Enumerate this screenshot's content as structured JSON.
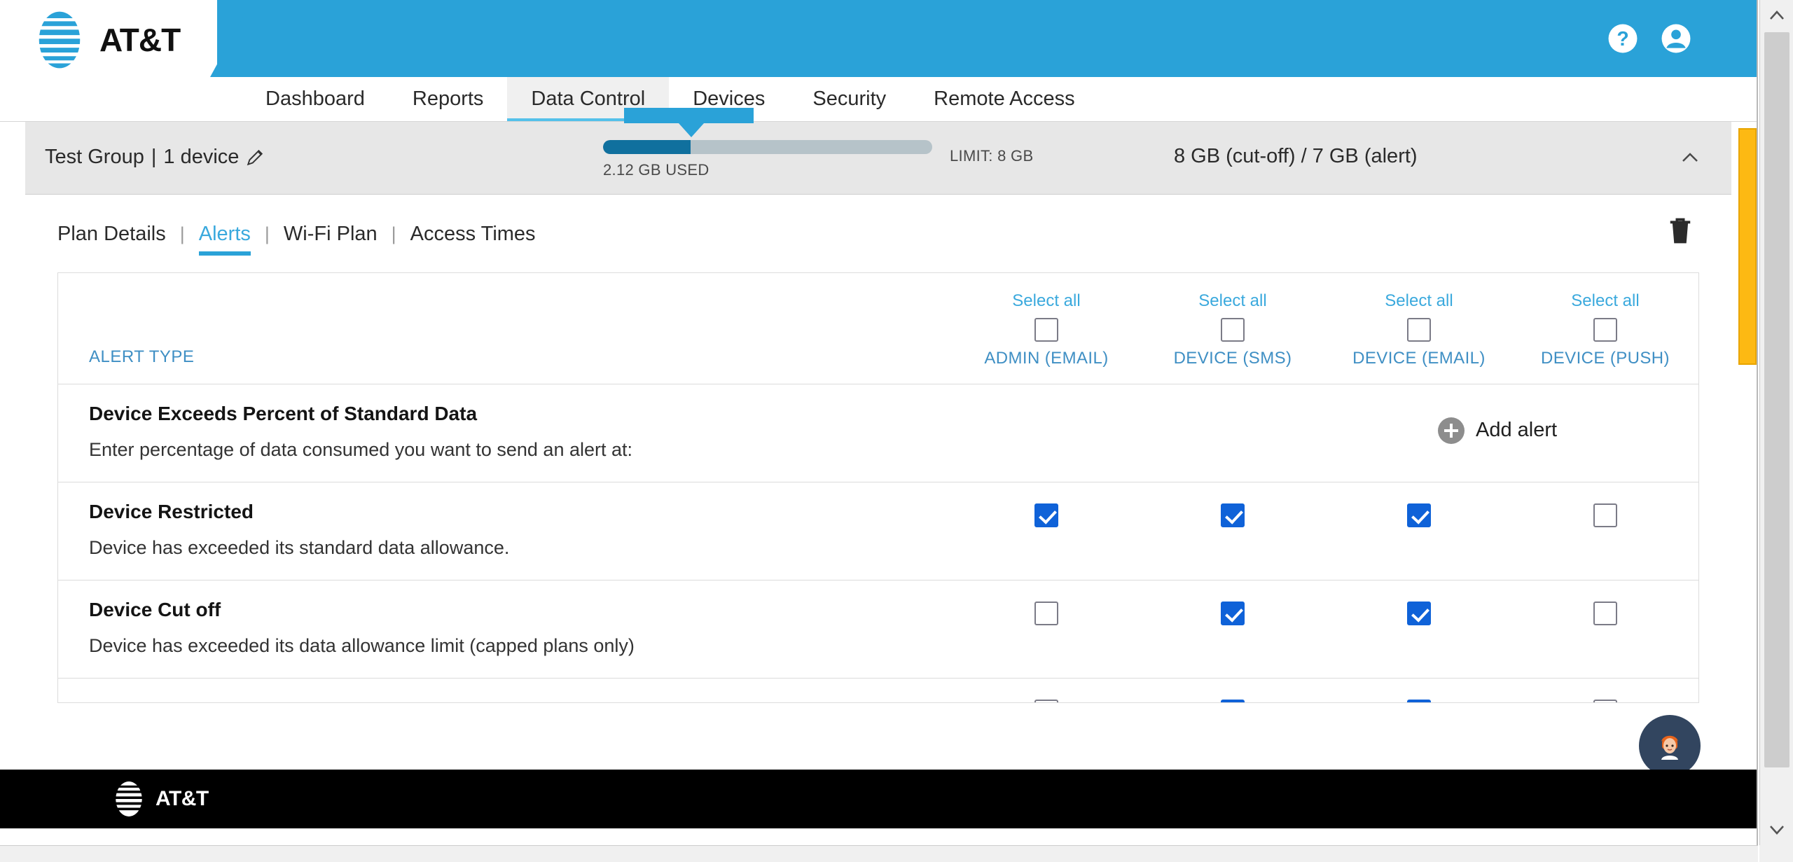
{
  "brand": {
    "name": "AT&T",
    "logo_icon": "att-globe-icon",
    "header_color": "#2aa2d8",
    "footer_name": "AT&T"
  },
  "header": {
    "help_icon": "help-circle-icon",
    "account_icon": "user-account-icon"
  },
  "nav": {
    "items": [
      {
        "label": "Dashboard",
        "active": false
      },
      {
        "label": "Reports",
        "active": false
      },
      {
        "label": "Data Control",
        "active": true
      },
      {
        "label": "Devices",
        "active": false
      },
      {
        "label": "Security",
        "active": false
      },
      {
        "label": "Remote Access",
        "active": false
      }
    ]
  },
  "group": {
    "name": "Test Group",
    "separator": "|",
    "device_count": "1 device",
    "edit_icon": "pencil-edit-icon",
    "usage_used": "2.12 GB USED",
    "usage_limit": "LIMIT: 8 GB",
    "usage_percent": 26.5,
    "thresholds": "8 GB (cut-off) / 7 GB (alert)",
    "collapse_icon": "chevron-up-icon",
    "bar_fill_color": "#10709e",
    "bar_track_color": "#b6c3c9"
  },
  "subtabs": {
    "items": [
      {
        "label": "Plan Details",
        "active": false
      },
      {
        "label": "Alerts",
        "active": true
      },
      {
        "label": "Wi-Fi Plan",
        "active": false
      },
      {
        "label": "Access Times",
        "active": false
      }
    ],
    "separator": "|",
    "delete_icon": "trash-delete-icon"
  },
  "alerts_table": {
    "type_column_header": "ALERT TYPE",
    "select_all_label": "Select all",
    "channels": [
      {
        "label": "ADMIN (EMAIL)",
        "select_all_checked": false
      },
      {
        "label": "DEVICE (SMS)",
        "select_all_checked": false
      },
      {
        "label": "DEVICE (EMAIL)",
        "select_all_checked": false
      },
      {
        "label": "DEVICE (PUSH)",
        "select_all_checked": false
      }
    ],
    "rows": [
      {
        "title": "Device Exceeds Percent of Standard Data",
        "description": "Enter percentage of data consumed you want to send an alert at:",
        "has_add_alert": true,
        "add_alert_label": "Add alert",
        "add_alert_icon": "plus-circle-icon",
        "checks": []
      },
      {
        "title": "Device Restricted",
        "description": "Device has exceeded its standard data allowance.",
        "has_add_alert": false,
        "checks": [
          true,
          true,
          true,
          false
        ]
      },
      {
        "title": "Device Cut off",
        "description": "Device has exceeded its data allowance limit (capped plans only)",
        "has_add_alert": false,
        "checks": [
          false,
          true,
          true,
          false
        ]
      }
    ]
  },
  "assistant": {
    "icon": "support-avatar-icon",
    "bg_color": "#32455f"
  },
  "scrollbar": {
    "up_icon": "scroll-up-arrow-icon",
    "down_icon": "scroll-down-arrow-icon",
    "marker_color": "#fdb913"
  }
}
